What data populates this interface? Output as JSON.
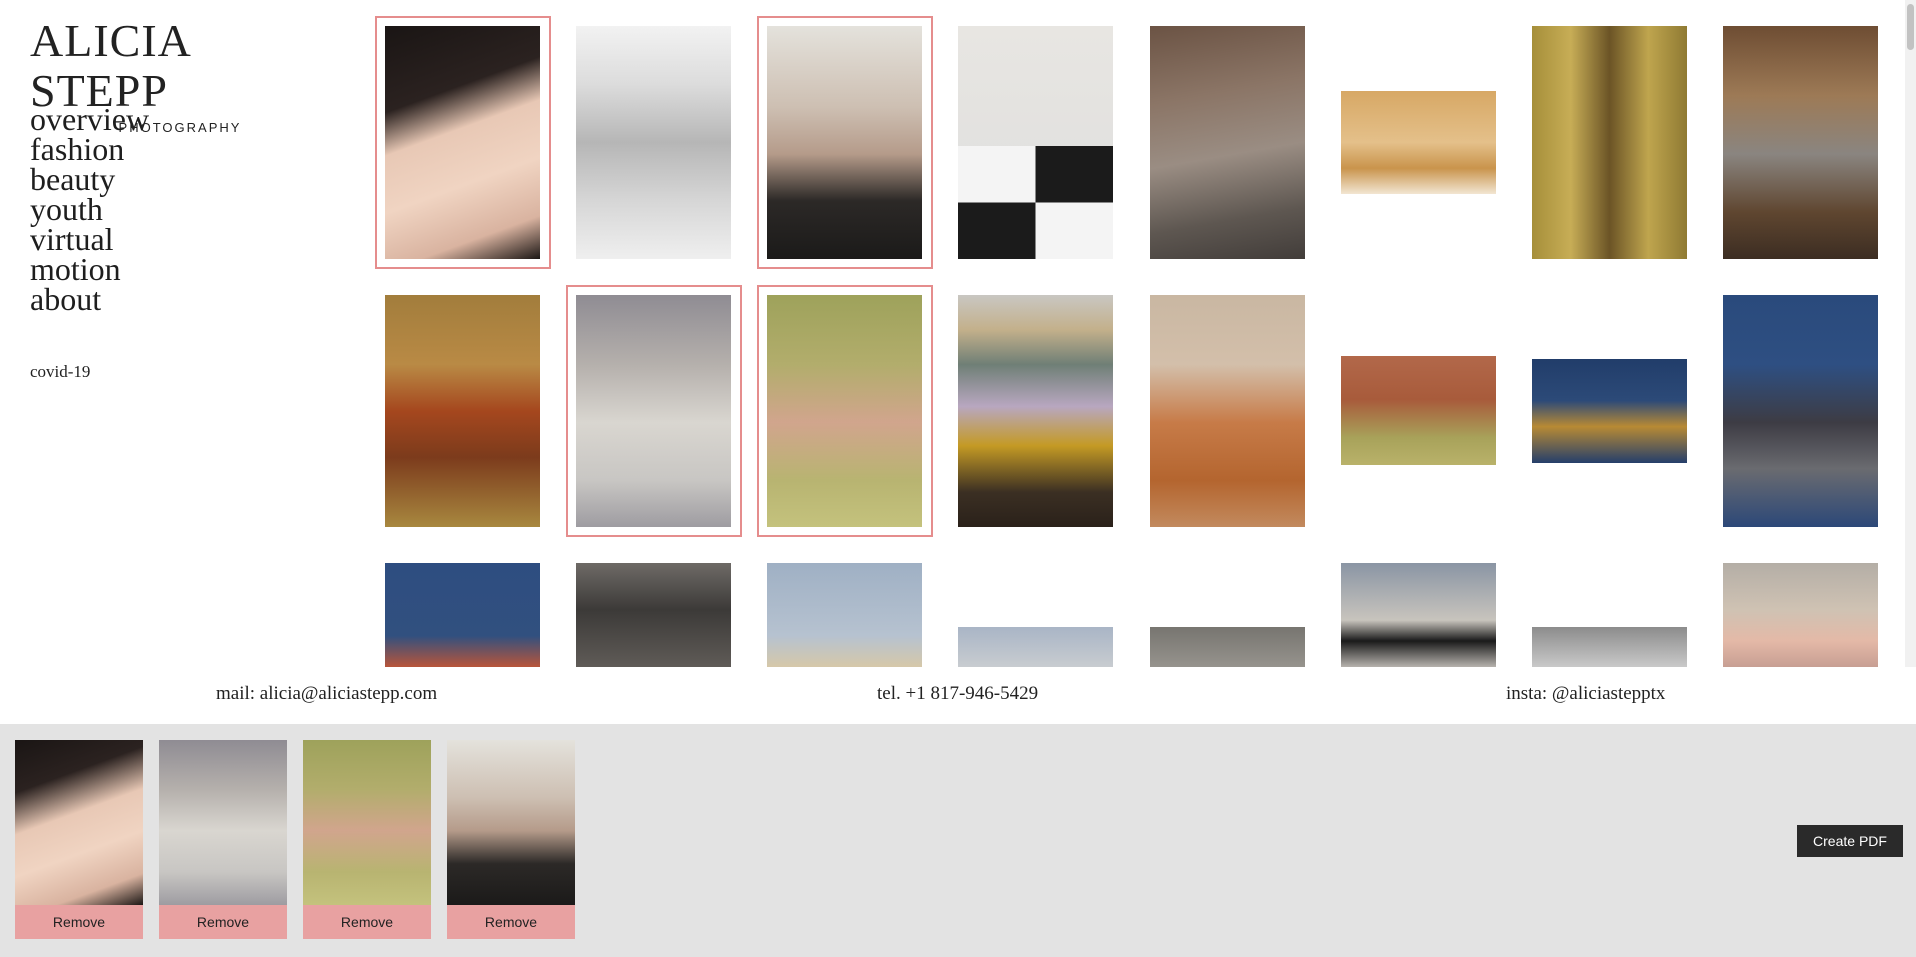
{
  "brand": {
    "name": "ALICIA STEPP",
    "subtitle": "PHOTOGRAPHY"
  },
  "nav": [
    "overview",
    "fashion",
    "beauty",
    "youth",
    "virtual",
    "motion",
    "about"
  ],
  "extra_link": "covid-19",
  "gallery_photos": [
    {
      "label": "close-up face",
      "selected": true
    },
    {
      "label": "black and white portrait",
      "selected": false
    },
    {
      "label": "leather jacket portrait",
      "selected": true
    },
    {
      "label": "checkered bow portrait",
      "selected": false
    },
    {
      "label": "sequin jacket portrait",
      "selected": false
    },
    {
      "label": "hallway gold dress",
      "selected": false
    },
    {
      "label": "gold dress curtain",
      "selected": false
    },
    {
      "label": "silver dress chandelier",
      "selected": false
    },
    {
      "label": "orange fur coat",
      "selected": false
    },
    {
      "label": "silver ruffle dress",
      "selected": true
    },
    {
      "label": "peach dress carpet",
      "selected": true
    },
    {
      "label": "tv and painting",
      "selected": false
    },
    {
      "label": "chandelier orange sequin",
      "selected": false
    },
    {
      "label": "reclining on carpet",
      "selected": false
    },
    {
      "label": "gold sequin blue sky",
      "selected": false
    },
    {
      "label": "silver sequin blue",
      "selected": false
    },
    {
      "label": "blue background portrait",
      "selected": false
    },
    {
      "label": "monochrome sequin",
      "selected": false
    },
    {
      "label": "sky figure",
      "selected": false
    },
    {
      "label": "pale portrait",
      "selected": false
    },
    {
      "label": "grey portrait",
      "selected": false
    },
    {
      "label": "sunglasses portrait",
      "selected": false
    },
    {
      "label": "building",
      "selected": false
    },
    {
      "label": "pink sunglasses",
      "selected": false
    }
  ],
  "contact": {
    "mail": "mail: alicia@aliciastepp.com",
    "tel": "tel. +1 817-946-5429",
    "insta": "insta: @aliciastepptx"
  },
  "pdf_tray": {
    "items": [
      {
        "label": "close-up face",
        "remove_label": "Remove"
      },
      {
        "label": "silver ruffle dress",
        "remove_label": "Remove"
      },
      {
        "label": "peach dress carpet",
        "remove_label": "Remove"
      },
      {
        "label": "leather jacket portrait",
        "remove_label": "Remove"
      }
    ],
    "create_label": "Create PDF"
  },
  "colors": {
    "selection_outline": "#e58d8d",
    "remove_button": "#e8a1a1",
    "tray_bg": "#e3e3e3",
    "pdf_button": "#2a2a2a"
  }
}
